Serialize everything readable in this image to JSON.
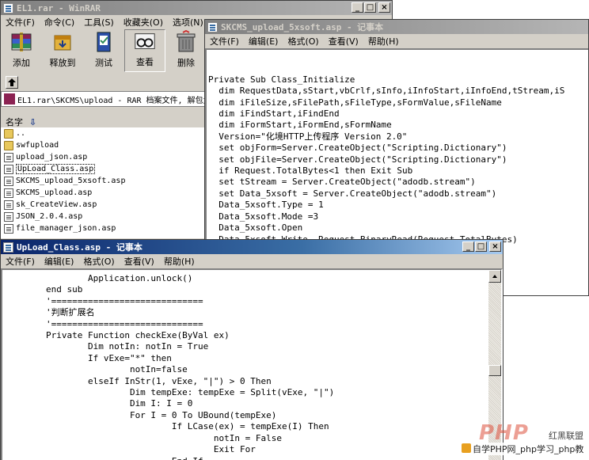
{
  "winrar": {
    "title": "EL1.rar - WinRAR",
    "menu": [
      "文件(F)",
      "命令(C)",
      "工具(S)",
      "收藏夹(O)",
      "选项(N)"
    ],
    "toolbar": [
      {
        "label": "添加",
        "icon": "add-archive-icon"
      },
      {
        "label": "释放到",
        "icon": "extract-to-icon"
      },
      {
        "label": "测试",
        "icon": "test-icon"
      },
      {
        "label": "查看",
        "icon": "view-icon"
      },
      {
        "label": "删除",
        "icon": "delete-icon"
      }
    ],
    "path": "EL1.rar\\SKCMS\\upload - RAR 档案文件, 解包大",
    "column_name": "名字",
    "files": [
      "..",
      "swfupload",
      "upload_json.asp",
      "UpLoad_Class.asp",
      "SKCMS_upload_5xsoft.asp",
      "SKCMS_upload.asp",
      "sk_CreateView.asp",
      "JSON_2.0.4.asp",
      "file_manager_json.asp"
    ]
  },
  "notepad_back": {
    "title": "SKCMS_upload_5xsoft.asp - 记事本",
    "menu": [
      "文件(F)",
      "编辑(E)",
      "格式(O)",
      "查看(V)",
      "帮助(H)"
    ],
    "lines": [
      "",
      "",
      "Private Sub Class_Initialize",
      "  dim RequestData,sStart,vbCrlf,sInfo,iInfoStart,iInfoEnd,tStream,iS",
      "  dim iFileSize,sFilePath,sFileType,sFormValue,sFileName",
      "  dim iFindStart,iFindEnd",
      "  dim iFormStart,iFormEnd,sFormName",
      "  Version=\"化境HTTP上传程序 Version 2.0\"",
      "  set objForm=Server.CreateObject(\"Scripting.Dictionary\")",
      "  set objFile=Server.CreateObject(\"Scripting.Dictionary\")",
      "  if Request.TotalBytes<1 then Exit Sub",
      "  set tStream = Server.CreateObject(\"adodb.stream\")",
      "  set Data_5xsoft = Server.CreateObject(\"adodb.stream\")",
      "  Data_5xsoft.Type = 1",
      "  Data_5xsoft.Mode =3",
      "  Data_5xsoft.Open",
      "  Data_5xsoft.Write  Request.BinaryRead(Request.TotalBytes)"
    ]
  },
  "notepad_front": {
    "title": "UpLoad_Class.asp - 记事本",
    "menu": [
      "文件(F)",
      "编辑(E)",
      "格式(O)",
      "查看(V)",
      "帮助(H)"
    ],
    "lines": [
      "                Application.unlock()",
      "        end sub",
      "        '=============================",
      "        '判断扩展名",
      "        '=============================",
      "        Private Function checkExe(ByVal ex)",
      "                Dim notIn: notIn = True",
      "                If vExe=\"*\" then",
      "                        notIn=false",
      "                elseIf InStr(1, vExe, \"|\") > 0 Then",
      "                        Dim tempExe: tempExe = Split(vExe, \"|\")",
      "                        Dim I: I = 0",
      "                        For I = 0 To UBound(tempExe)",
      "                                If LCase(ex) = tempExe(I) Then",
      "                                        notIn = False",
      "                                        Exit For",
      "                                End If"
    ]
  },
  "watermark": {
    "logo": "PHP",
    "brand": "红黑联盟",
    "caption": "自学PHP网_php学习_php教"
  }
}
